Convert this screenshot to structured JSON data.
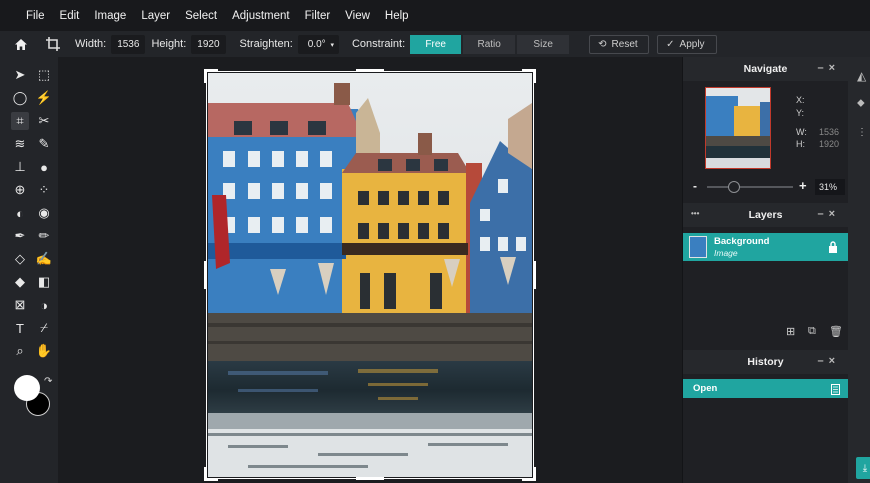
{
  "menu": [
    "File",
    "Edit",
    "Image",
    "Layer",
    "Select",
    "Adjustment",
    "Filter",
    "View",
    "Help"
  ],
  "options": {
    "width_label": "Width:",
    "width_value": "1536",
    "height_label": "Height:",
    "height_value": "1920",
    "straighten_label": "Straighten:",
    "straighten_value": "0.0°",
    "constraint_label": "Constraint:",
    "constraint_options": [
      "Free",
      "Ratio",
      "Size"
    ],
    "constraint_selected": "Free",
    "reset_label": "Reset",
    "apply_label": "Apply"
  },
  "tools": [
    "move-icon",
    "marquee-icon",
    "lasso-icon",
    "magic-wand-icon",
    "crop-icon",
    "cut-icon",
    "liquify-icon",
    "healing-icon",
    "stamp-icon",
    "drop-icon",
    "globe-icon",
    "dots-icon",
    "dodge-icon",
    "sponge-icon",
    "pen-icon",
    "brush-icon",
    "eraser-icon",
    "smudge-icon",
    "fill-icon",
    "gradient-icon",
    "frame-icon",
    "shape-icon",
    "text-icon",
    "eyedropper-icon",
    "zoom-icon",
    "hand-icon"
  ],
  "navigate": {
    "title": "Navigate",
    "x_label": "X:",
    "y_label": "Y:",
    "w_label": "W:",
    "w_value": "1536",
    "h_label": "H:",
    "h_value": "1920",
    "zoom_percent": 31,
    "zoom_label": "31%",
    "minus": "-",
    "plus": "+"
  },
  "layers": {
    "title": "Layers",
    "dots": "•••",
    "items": [
      {
        "name": "Background",
        "type": "Image",
        "locked": true
      }
    ]
  },
  "history": {
    "title": "History",
    "items": [
      {
        "label": "Open"
      }
    ]
  },
  "colors": {
    "accent": "#20a5a0",
    "primary": "#ffffff",
    "secondary": "#000000"
  }
}
